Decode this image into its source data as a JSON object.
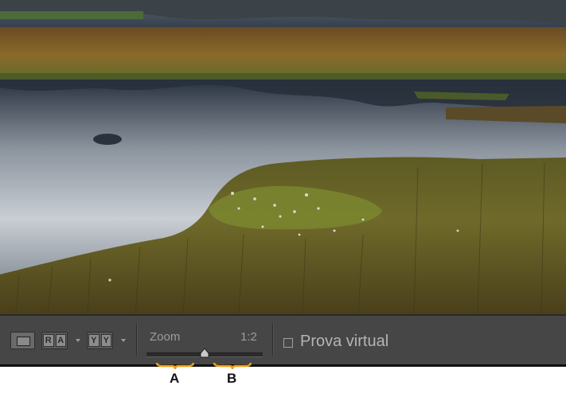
{
  "photo": {
    "description_icon": "landscape-photo"
  },
  "toolbar": {
    "loupe_icon": "loupe-view-icon",
    "before_after_lr": {
      "left": "R",
      "right": "A"
    },
    "before_after_tb": {
      "left": "Y",
      "right": "Y"
    },
    "zoom_label": "Zoom",
    "zoom_ratio": "1:2",
    "zoom_value_fraction": 0.5,
    "softproof_label": "Prova virtual",
    "softproof_checked": false
  },
  "callouts": {
    "a": "A",
    "b": "B",
    "color": "#f39c12"
  }
}
